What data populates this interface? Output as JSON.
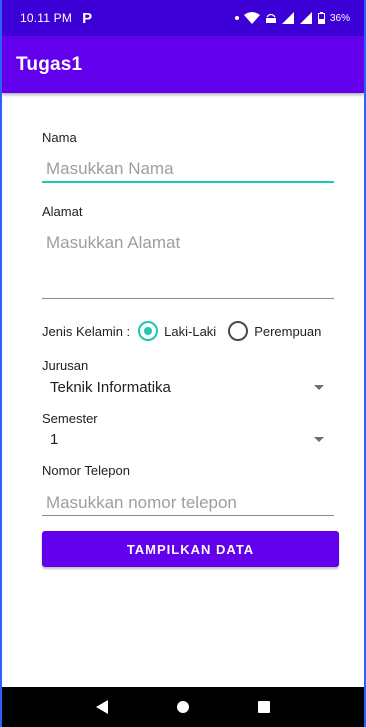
{
  "status_bar": {
    "time": "10.11 PM",
    "app_glyph": "P",
    "battery": "36%"
  },
  "app_bar": {
    "title": "Tugas1"
  },
  "form": {
    "nama": {
      "label": "Nama",
      "placeholder": "Masukkan Nama",
      "value": ""
    },
    "alamat": {
      "label": "Alamat",
      "placeholder": "Masukkan Alamat",
      "value": ""
    },
    "jenis_kelamin": {
      "label": "Jenis Kelamin :",
      "options": [
        {
          "label": "Laki-Laki",
          "checked": true
        },
        {
          "label": "Perempuan",
          "checked": false
        }
      ]
    },
    "jurusan": {
      "label": "Jurusan",
      "selected": "Teknik Informatika"
    },
    "semester": {
      "label": "Semester",
      "selected": "1"
    },
    "nomor_telepon": {
      "label": "Nomor Telepon",
      "placeholder": "Masukkan nomor telepon",
      "value": ""
    },
    "submit_label": "TAMPILKAN DATA"
  },
  "colors": {
    "status_bar": "#3c00d6",
    "app_bar": "#6200ee",
    "accent": "#1ec8b4",
    "button": "#6200ee"
  }
}
